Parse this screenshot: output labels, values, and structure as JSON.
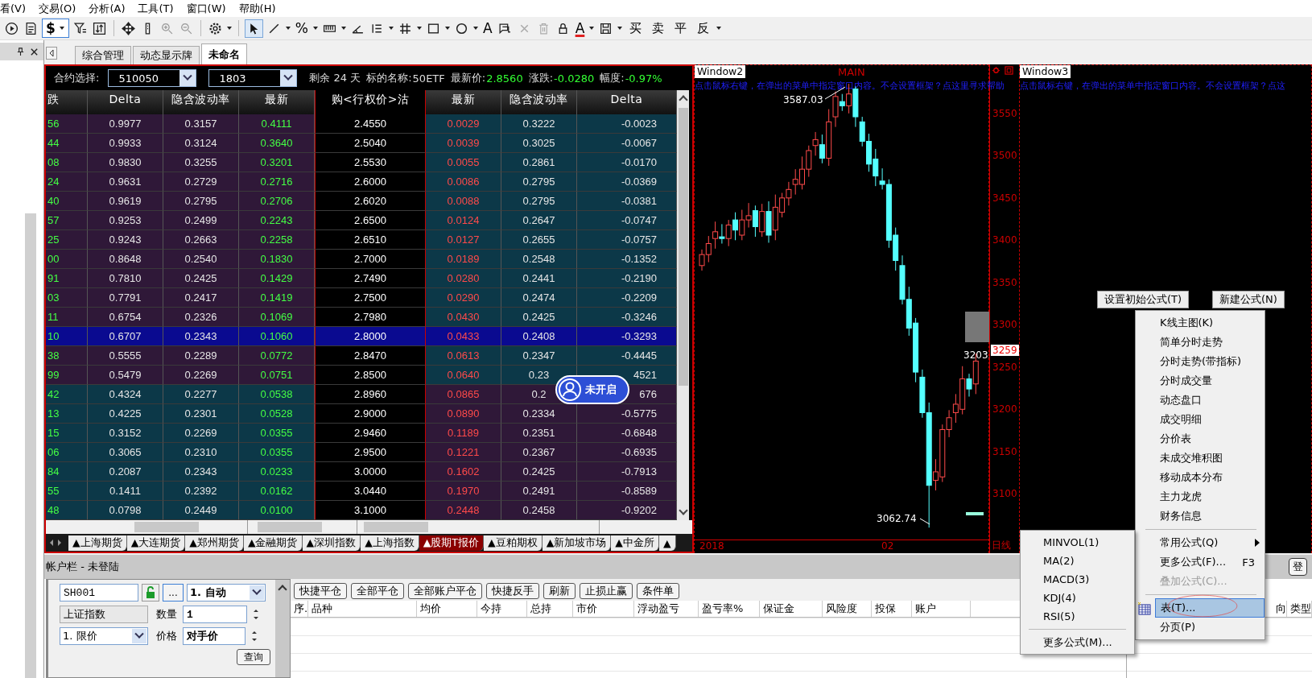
{
  "menu_bar": [
    "看(V)",
    "交易(O)",
    "分析(A)",
    "工具(T)",
    "窗口(W)",
    "帮助(H)"
  ],
  "toolbar": {
    "currency_symbol": "$",
    "percent_symbol": "%",
    "text_symbol": "A",
    "font_color_symbol": "A",
    "trade_buttons": [
      "买",
      "卖",
      "平",
      "反"
    ]
  },
  "tabs": [
    {
      "label": "综合管理",
      "selected": false
    },
    {
      "label": "动态显示牌",
      "selected": false
    },
    {
      "label": "未命名",
      "selected": true
    }
  ],
  "quote_panel": {
    "contract_label": "合约选择:",
    "underlying_code": "510050",
    "expiry": "1803",
    "remaining": "剩余 24 天",
    "underlying_name_label": "标的名称:",
    "underlying_name": "50ETF",
    "last_price_label": "最新价:",
    "last_price": "2.8560",
    "change_label": "涨跌:",
    "change": "-0.0280",
    "range_label": "幅度:",
    "range": "-0.97%"
  },
  "options_table": {
    "columns": [
      "跌",
      "Delta",
      "隐含波动率",
      "最新",
      "购<行权价>沽",
      "最新",
      "隐含波动率",
      "Delta"
    ],
    "rows": [
      {
        "change": "56",
        "delta": "0.9977",
        "iv": "0.3157",
        "last": "0.4111",
        "strike": "2.4550",
        "put_last": "0.0029",
        "put_iv": "0.3222",
        "put_delta": "-0.0023",
        "call_in_money": true,
        "selected": false
      },
      {
        "change": "44",
        "delta": "0.9933",
        "iv": "0.3124",
        "last": "0.3640",
        "strike": "2.5040",
        "put_last": "0.0039",
        "put_iv": "0.3025",
        "put_delta": "-0.0067",
        "call_in_money": true,
        "selected": false
      },
      {
        "change": "08",
        "delta": "0.9830",
        "iv": "0.3255",
        "last": "0.3201",
        "strike": "2.5530",
        "put_last": "0.0055",
        "put_iv": "0.2861",
        "put_delta": "-0.0170",
        "call_in_money": true,
        "selected": false
      },
      {
        "change": "24",
        "delta": "0.9631",
        "iv": "0.2729",
        "last": "0.2716",
        "strike": "2.6000",
        "put_last": "0.0086",
        "put_iv": "0.2795",
        "put_delta": "-0.0369",
        "call_in_money": true,
        "selected": false
      },
      {
        "change": "40",
        "delta": "0.9619",
        "iv": "0.2795",
        "last": "0.2706",
        "strike": "2.6020",
        "put_last": "0.0088",
        "put_iv": "0.2795",
        "put_delta": "-0.0381",
        "call_in_money": true,
        "selected": false
      },
      {
        "change": "57",
        "delta": "0.9253",
        "iv": "0.2499",
        "last": "0.2243",
        "strike": "2.6500",
        "put_last": "0.0124",
        "put_iv": "0.2647",
        "put_delta": "-0.0747",
        "call_in_money": true,
        "selected": false
      },
      {
        "change": "25",
        "delta": "0.9243",
        "iv": "0.2663",
        "last": "0.2258",
        "strike": "2.6510",
        "put_last": "0.0127",
        "put_iv": "0.2655",
        "put_delta": "-0.0757",
        "call_in_money": true,
        "selected": false
      },
      {
        "change": "00",
        "delta": "0.8648",
        "iv": "0.2540",
        "last": "0.1830",
        "strike": "2.7000",
        "put_last": "0.0189",
        "put_iv": "0.2548",
        "put_delta": "-0.1352",
        "call_in_money": true,
        "selected": false
      },
      {
        "change": "91",
        "delta": "0.7810",
        "iv": "0.2425",
        "last": "0.1429",
        "strike": "2.7490",
        "put_last": "0.0280",
        "put_iv": "0.2441",
        "put_delta": "-0.2190",
        "call_in_money": true,
        "selected": false
      },
      {
        "change": "03",
        "delta": "0.7791",
        "iv": "0.2417",
        "last": "0.1419",
        "strike": "2.7500",
        "put_last": "0.0290",
        "put_iv": "0.2474",
        "put_delta": "-0.2209",
        "call_in_money": true,
        "selected": false
      },
      {
        "change": "11",
        "delta": "0.6754",
        "iv": "0.2326",
        "last": "0.1069",
        "strike": "2.7980",
        "put_last": "0.0430",
        "put_iv": "0.2425",
        "put_delta": "-0.3246",
        "call_in_money": true,
        "selected": false
      },
      {
        "change": "10",
        "delta": "0.6707",
        "iv": "0.2343",
        "last": "0.1060",
        "strike": "2.8000",
        "put_last": "0.0433",
        "put_iv": "0.2408",
        "put_delta": "-0.3293",
        "call_in_money": true,
        "selected": true
      },
      {
        "change": "38",
        "delta": "0.5555",
        "iv": "0.2289",
        "last": "0.0772",
        "strike": "2.8470",
        "put_last": "0.0613",
        "put_iv": "0.2347",
        "put_delta": "-0.4445",
        "call_in_money": true,
        "selected": false
      },
      {
        "change": "99",
        "delta": "0.5479",
        "iv": "0.2269",
        "last": "0.0751",
        "strike": "2.8500",
        "put_last": "0.0640",
        "put_iv": "0.23",
        "put_delta": "4521",
        "call_in_money": true,
        "selected": false
      },
      {
        "change": "42",
        "delta": "0.4324",
        "iv": "0.2277",
        "last": "0.0538",
        "strike": "2.8960",
        "put_last": "0.0865",
        "put_iv": "0.2",
        "put_delta": "676",
        "call_in_money": false,
        "selected": false
      },
      {
        "change": "13",
        "delta": "0.4225",
        "iv": "0.2301",
        "last": "0.0528",
        "strike": "2.9000",
        "put_last": "0.0890",
        "put_iv": "0.2334",
        "put_delta": "-0.5775",
        "call_in_money": false,
        "selected": false
      },
      {
        "change": "15",
        "delta": "0.3152",
        "iv": "0.2269",
        "last": "0.0355",
        "strike": "2.9460",
        "put_last": "0.1189",
        "put_iv": "0.2351",
        "put_delta": "-0.6848",
        "call_in_money": false,
        "selected": false
      },
      {
        "change": "06",
        "delta": "0.3065",
        "iv": "0.2310",
        "last": "0.0355",
        "strike": "2.9500",
        "put_last": "0.1221",
        "put_iv": "0.2367",
        "put_delta": "-0.6935",
        "call_in_money": false,
        "selected": false
      },
      {
        "change": "84",
        "delta": "0.2087",
        "iv": "0.2343",
        "last": "0.0233",
        "strike": "3.0000",
        "put_last": "0.1602",
        "put_iv": "0.2425",
        "put_delta": "-0.7913",
        "call_in_money": false,
        "selected": false
      },
      {
        "change": "55",
        "delta": "0.1411",
        "iv": "0.2392",
        "last": "0.0162",
        "strike": "3.0440",
        "put_last": "0.1970",
        "put_iv": "0.2491",
        "put_delta": "-0.8589",
        "call_in_money": false,
        "selected": false
      },
      {
        "change": "48",
        "delta": "0.0798",
        "iv": "0.2449",
        "last": "0.0100",
        "strike": "3.1000",
        "put_last": "0.2448",
        "put_iv": "0.2458",
        "put_delta": "-0.9202",
        "call_in_money": false,
        "selected": false
      }
    ],
    "badge": "未开启",
    "sheet_tabs": [
      {
        "label": "▲上海期货",
        "selected": false
      },
      {
        "label": "▲大连期货",
        "selected": false
      },
      {
        "label": "▲郑州期货",
        "selected": false
      },
      {
        "label": "▲金融期货",
        "selected": false
      },
      {
        "label": "▲深圳指数",
        "selected": false
      },
      {
        "label": "▲上海指数",
        "selected": false
      },
      {
        "label": "▲股期T报价",
        "selected": true
      },
      {
        "label": "▲豆粕期权",
        "selected": false
      },
      {
        "label": "▲新加坡市场",
        "selected": false
      },
      {
        "label": "▲中金所",
        "selected": false
      },
      {
        "label": "▲",
        "selected": false
      }
    ]
  },
  "chart": {
    "window2": {
      "title": "Window2",
      "main_label": "MAIN",
      "hint": "点击鼠标右键，在弹出的菜单中指定窗口内容。不会设置框架？点这里寻求帮助",
      "high_label": "3587.03",
      "low_label": "3062.74",
      "cut_label": "3203.",
      "price_tag": "3259",
      "period": "日线",
      "chart_data": {
        "type": "candlestick",
        "ylim": [
          3047,
          3609
        ],
        "ohlc": [
          [
            3372,
            3391,
            3366,
            3385
          ],
          [
            3385,
            3407,
            3376,
            3398
          ],
          [
            3404,
            3424,
            3392,
            3412
          ],
          [
            3406,
            3421,
            3398,
            3404
          ],
          [
            3404,
            3426,
            3395,
            3420
          ],
          [
            3426,
            3435,
            3402,
            3414
          ],
          [
            3408,
            3438,
            3402,
            3426
          ],
          [
            3426,
            3446,
            3417,
            3431
          ],
          [
            3437,
            3443,
            3406,
            3418
          ],
          [
            3412,
            3445,
            3406,
            3436
          ],
          [
            3436,
            3448,
            3399,
            3408
          ],
          [
            3414,
            3456,
            3402,
            3441
          ],
          [
            3435,
            3458,
            3429,
            3452
          ],
          [
            3452,
            3471,
            3443,
            3462
          ],
          [
            3468,
            3486,
            3456,
            3474
          ],
          [
            3468,
            3501,
            3462,
            3486
          ],
          [
            3486,
            3514,
            3477,
            3508
          ],
          [
            3514,
            3530,
            3502,
            3521
          ],
          [
            3515,
            3527,
            3493,
            3499
          ],
          [
            3499,
            3557,
            3490,
            3542
          ],
          [
            3548,
            3578,
            3536,
            3572
          ],
          [
            3566,
            3575,
            3555,
            3561
          ],
          [
            3561,
            3587,
            3552,
            3575
          ],
          [
            3581,
            3584,
            3536,
            3548
          ],
          [
            3542,
            3548,
            3513,
            3519
          ],
          [
            3519,
            3528,
            3483,
            3492
          ],
          [
            3498,
            3510,
            3466,
            3478
          ],
          [
            3472,
            3487,
            3462,
            3468
          ],
          [
            3468,
            3474,
            3393,
            3402
          ],
          [
            3408,
            3417,
            3366,
            3378
          ],
          [
            3372,
            3384,
            3326,
            3332
          ],
          [
            3332,
            3347,
            3289,
            3298
          ],
          [
            3304,
            3310,
            3234,
            3246
          ],
          [
            3240,
            3249,
            3192,
            3198
          ],
          [
            3198,
            3210,
            3062,
            3112
          ],
          [
            3118,
            3143,
            3106,
            3128
          ],
          [
            3122,
            3184,
            3116,
            3178
          ],
          [
            3178,
            3201,
            3169,
            3192
          ],
          [
            3198,
            3220,
            3186,
            3208
          ],
          [
            3202,
            3253,
            3196,
            3238
          ],
          [
            3238,
            3244,
            3217,
            3226
          ],
          [
            3232,
            3268,
            3220,
            3259
          ]
        ],
        "yticks": [
          3550,
          3500,
          3450,
          3400,
          3350,
          3300,
          3250,
          3200,
          3150,
          3100
        ]
      },
      "date_labels": [
        "2018",
        "02"
      ]
    },
    "window3": {
      "title": "Window3",
      "hint": "点击鼠标右键，在弹出的菜单中指定窗口内容。不会设置框架？点这"
    }
  },
  "context_menu": {
    "background_buttons": [
      "设置初始公式(T)",
      "新建公式(N)"
    ],
    "items": [
      {
        "kind": "item",
        "label": "K线主图(K)",
        "disabled": false,
        "selected": false
      },
      {
        "kind": "item",
        "label": "简单分时走势",
        "disabled": false,
        "selected": false
      },
      {
        "kind": "item",
        "label": "分时走势(带指标)",
        "disabled": false,
        "selected": false
      },
      {
        "kind": "item",
        "label": "分时成交量",
        "disabled": false,
        "selected": false
      },
      {
        "kind": "item",
        "label": "动态盘口",
        "disabled": false,
        "selected": false
      },
      {
        "kind": "item",
        "label": "成交明细",
        "disabled": false,
        "selected": false
      },
      {
        "kind": "item",
        "label": "分价表",
        "disabled": false,
        "selected": false
      },
      {
        "kind": "item",
        "label": "未成交堆积图",
        "disabled": false,
        "selected": false
      },
      {
        "kind": "item",
        "label": "移动成本分布",
        "disabled": false,
        "selected": false
      },
      {
        "kind": "item",
        "label": "主力龙虎",
        "disabled": false,
        "selected": false
      },
      {
        "kind": "item",
        "label": "财务信息",
        "disabled": false,
        "selected": false
      },
      {
        "kind": "separator"
      },
      {
        "kind": "submenu",
        "label": "常用公式(Q)",
        "expanded": true,
        "disabled": false,
        "selected": false
      },
      {
        "kind": "item",
        "label": "更多公式(F)...",
        "shortcut": "F3",
        "disabled": false,
        "selected": false
      },
      {
        "kind": "item",
        "label": "叠加公式(C)...",
        "disabled": true,
        "selected": false
      },
      {
        "kind": "separator"
      },
      {
        "kind": "item",
        "label": "表(T)...",
        "disabled": false,
        "selected": true
      },
      {
        "kind": "item",
        "label": "分页(P)",
        "disabled": false,
        "selected": false
      }
    ],
    "submenu": {
      "items": [
        "MINVOL(1)",
        "MA(2)",
        "MACD(3)",
        "KDJ(4)",
        "RSI(5)"
      ],
      "more": "更多公式(M)..."
    }
  },
  "account": {
    "title": "帐户栏 - 未登陆",
    "account_id": "SH001",
    "more_button": "...",
    "mode": "1. 自动",
    "instrument": "上证指数",
    "quantity_label": "数量",
    "quantity": "1",
    "order_type": "1. 限价",
    "price_label": "价格",
    "price": "对手价",
    "query_button": "查询",
    "actions": [
      "快捷平仓",
      "全部平仓",
      "全部账户平仓",
      "快捷反手",
      "刷新",
      "止损止赢",
      "条件单"
    ],
    "columns": [
      "序.",
      "品种",
      "均价",
      "今持",
      "总持",
      "市价",
      "浮动盈亏",
      "盈亏率%",
      "保证金",
      "风险度",
      "投保",
      "账户"
    ],
    "right_button": "登",
    "right_columns": [
      "向",
      "类型"
    ]
  }
}
